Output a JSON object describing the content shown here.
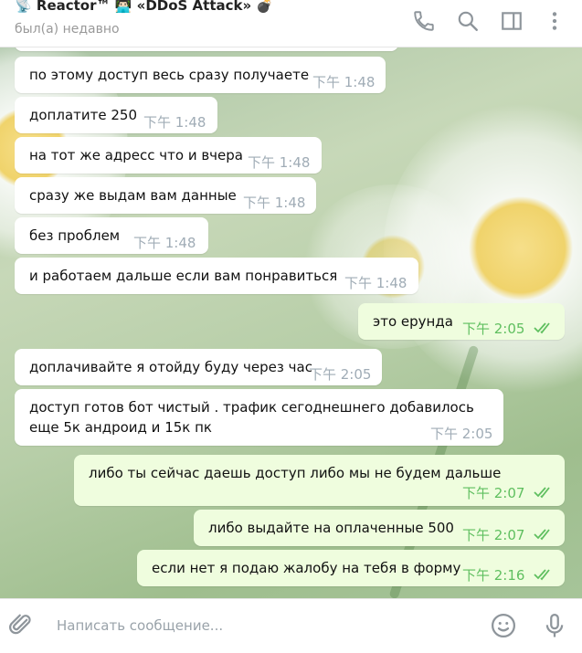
{
  "header": {
    "title": "📡 Reactor™ 👨🏻‍💻 «DDoS Attack» 💣",
    "status": "был(а) недавно"
  },
  "icons": {
    "call": "phone-icon",
    "search": "search-icon",
    "sidebar": "sidebar-toggle-icon",
    "more": "more-vertical-icon",
    "attach": "paperclip-icon",
    "emoji": "smiley-icon",
    "mic": "microphone-icon",
    "read": "double-check-icon"
  },
  "colors": {
    "incoming_bubble": "#ffffff",
    "outgoing_bubble": "#effdde",
    "outgoing_time": "#5fbf5f",
    "incoming_time": "#a0acb6"
  },
  "messages": [
    {
      "dir": "in",
      "text": "по этому доступ весь сразу получаете",
      "time": "下午 1:48"
    },
    {
      "dir": "in",
      "text": "доплатите 250",
      "time": "下午 1:48"
    },
    {
      "dir": "in",
      "text": "на тот же адресс что и вчера",
      "time": "下午 1:48"
    },
    {
      "dir": "in",
      "text": "сразу же выдам вам данные",
      "time": "下午 1:48"
    },
    {
      "dir": "in",
      "text": "без проблем",
      "time": "下午 1:48"
    },
    {
      "dir": "in",
      "text": "и работаем дальше если вам понравиться",
      "time": "下午 1:48"
    },
    {
      "dir": "out",
      "text": "это ерунда",
      "time": "下午 2:05"
    },
    {
      "dir": "in",
      "text": "доплачивайте я отойду буду через час",
      "time": "下午 2:05"
    },
    {
      "dir": "in",
      "text_line1": "доступ готов бот чистый . трафик сегоднешнего добавилось",
      "text_line2": "еще 5к андроид и 15к пк",
      "time": "下午 2:05"
    },
    {
      "dir": "out",
      "text": "либо ты сейчас даешь доступ либо мы не будем дальше",
      "time": "下午 2:07"
    },
    {
      "dir": "out",
      "text": "либо выдайте на оплаченные 500",
      "time": "下午 2:07"
    },
    {
      "dir": "out",
      "text": "если нет я подаю жалобу на тебя в форму",
      "time": "下午 2:16"
    }
  ],
  "composer": {
    "placeholder": "Написать сообщение..."
  }
}
